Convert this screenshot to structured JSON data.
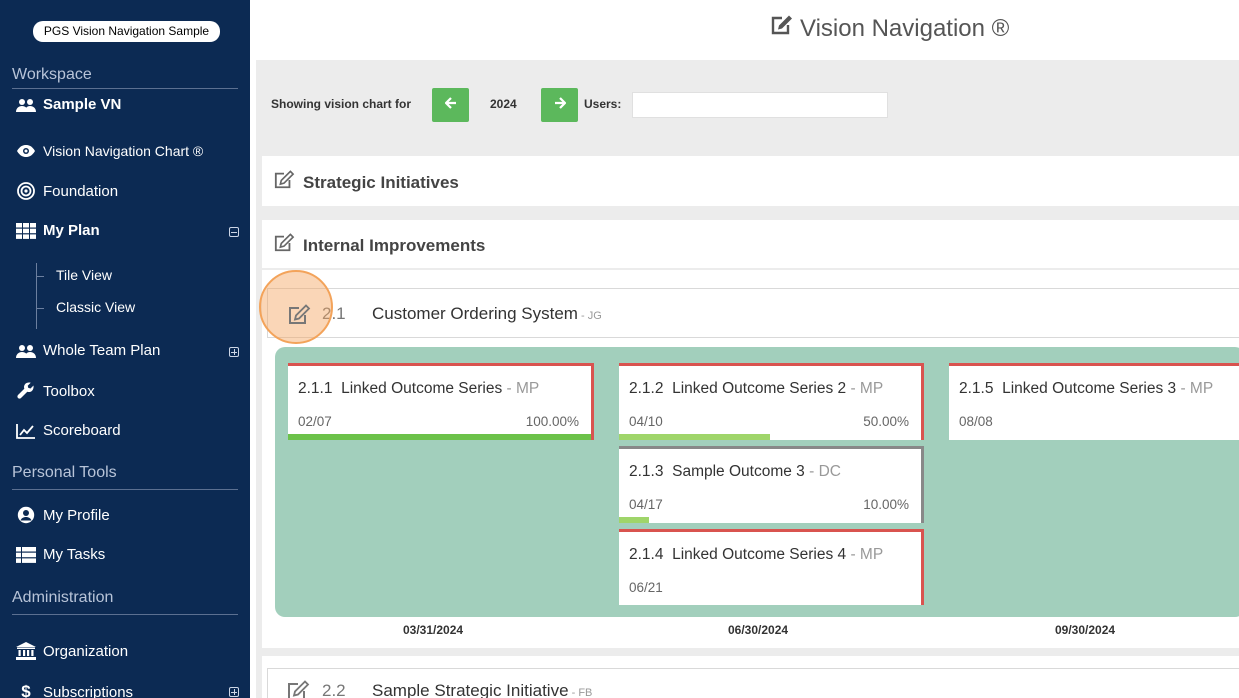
{
  "sidebar": {
    "brand": "PGS Vision Navigation Sample",
    "workspace_label": "Workspace",
    "workspace_name": "Sample VN",
    "items": {
      "vision_chart": "Vision Navigation Chart ®",
      "foundation": "Foundation",
      "my_plan": "My Plan",
      "tile_view": "Tile View",
      "classic_view": "Classic View",
      "whole_team_plan": "Whole Team Plan",
      "toolbox": "Toolbox",
      "scoreboard": "Scoreboard"
    },
    "personal_tools_label": "Personal Tools",
    "personal": {
      "my_profile": "My Profile",
      "my_tasks": "My Tasks"
    },
    "administration_label": "Administration",
    "admin": {
      "organization": "Organization",
      "subscriptions": "Subscriptions"
    }
  },
  "header": {
    "title": "Vision Navigation ®"
  },
  "toolbar": {
    "showing_label": "Showing vision chart for",
    "year": "2024",
    "users_label": "Users:",
    "users_value": ""
  },
  "sections": {
    "strategic": "Strategic Initiatives",
    "internal": "Internal Improvements"
  },
  "initiative": {
    "number": "2.1",
    "name": "Customer Ordering System",
    "owner": " - JG"
  },
  "cards": [
    {
      "id": "2.1.1",
      "title": "Linked Outcome Series",
      "owner": " - MP",
      "date": "02/07",
      "percent": "100.00%",
      "progress": 1.0,
      "bar_color": "#6cc24a",
      "border": "#d9534f"
    },
    {
      "id": "2.1.2",
      "title": "Linked Outcome Series 2",
      "owner": " - MP",
      "date": "04/10",
      "percent": "50.00%",
      "progress": 0.5,
      "bar_color": "#9fd56a",
      "border": "#d9534f"
    },
    {
      "id": "2.1.5",
      "title": "Linked Outcome Series 3",
      "owner": " - MP",
      "date": "08/08",
      "percent": "",
      "progress": 0,
      "bar_color": "#9fd56a",
      "border": "#d9534f"
    },
    {
      "id": "2.1.3",
      "title": "Sample Outcome 3",
      "owner": " - DC",
      "date": "04/17",
      "percent": "10.00%",
      "progress": 0.1,
      "bar_color": "#9fd56a",
      "border": "#888888"
    },
    {
      "id": "2.1.4",
      "title": "Linked Outcome Series 4",
      "owner": " - MP",
      "date": "06/21",
      "percent": "",
      "progress": 0,
      "bar_color": "#9fd56a",
      "border": "#d9534f"
    }
  ],
  "axis_dates": [
    "03/31/2024",
    "06/30/2024",
    "09/30/2024"
  ],
  "next_initiative": {
    "number": "2.2",
    "name": "Sample Strategic Initiative",
    "owner": " - FB"
  },
  "colors": {
    "sidebar_bg": "#0c2a53",
    "accent_green": "#5cb85c",
    "timeline_bg": "#a2cfbc",
    "highlight": "#f3a35a",
    "card_alert_border": "#d9534f"
  },
  "icons": {
    "workspace": "users-icon",
    "vision_chart": "eye-icon",
    "foundation": "bullseye-icon",
    "my_plan": "grid-icon",
    "whole_team_plan": "users-icon",
    "toolbox": "wrench-icon",
    "scoreboard": "line-chart-icon",
    "my_profile": "user-circle-icon",
    "my_tasks": "list-icon",
    "organization": "bank-icon",
    "subscriptions": "dollar-icon",
    "edit": "edit-icon",
    "prev": "arrow-left-icon",
    "next": "arrow-right-icon"
  }
}
